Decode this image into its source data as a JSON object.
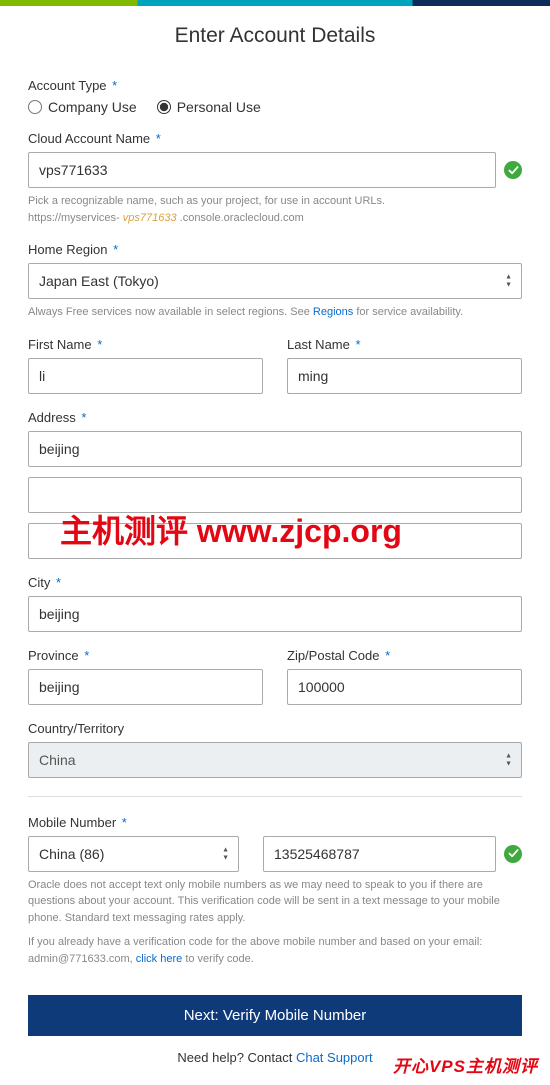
{
  "page": {
    "title": "Enter Account Details"
  },
  "account_type": {
    "label": "Account Type",
    "options": {
      "company": "Company Use",
      "personal": "Personal Use"
    },
    "selected": "personal"
  },
  "account_name": {
    "label": "Cloud Account Name",
    "value": "vps771633",
    "hint_prefix": "Pick a recognizable name, such as your project, for use in account URLs.",
    "hint_url_prefix": "https://myservices-",
    "hint_url_highlight": "vps771633",
    "hint_url_suffix": ".console.oraclecloud.com"
  },
  "home_region": {
    "label": "Home Region",
    "value": "Japan East (Tokyo)",
    "hint_prefix": "Always Free services now available in select regions. See ",
    "hint_link": "Regions",
    "hint_suffix": " for service availability."
  },
  "first_name": {
    "label": "First Name",
    "value": "li"
  },
  "last_name": {
    "label": "Last Name",
    "value": "ming"
  },
  "address": {
    "label": "Address",
    "line1": "beijing",
    "line2": "",
    "line3": ""
  },
  "city": {
    "label": "City",
    "value": "beijing"
  },
  "province": {
    "label": "Province",
    "value": "beijing"
  },
  "zip": {
    "label": "Zip/Postal Code",
    "value": "100000"
  },
  "country": {
    "label": "Country/Territory",
    "value": "China"
  },
  "mobile": {
    "label": "Mobile Number",
    "country_code": "China (86)",
    "number": "13525468787",
    "hint1": "Oracle does not accept text only mobile numbers as we may need to speak to you if there are questions about your account. This verification code will be sent in a text message to your mobile phone. Standard text messaging rates apply.",
    "hint2_prefix": "If you already have a verification code for the above mobile number and based on your email: admin@771633.com, ",
    "hint2_link": "click here",
    "hint2_suffix": " to verify code."
  },
  "next_button": "Next: Verify Mobile Number",
  "footer": {
    "text": "Need help? Contact ",
    "link": "Chat Support"
  },
  "watermark1": "主机测评  www.zjcp.org",
  "watermark2": "开心VPS主机测评"
}
